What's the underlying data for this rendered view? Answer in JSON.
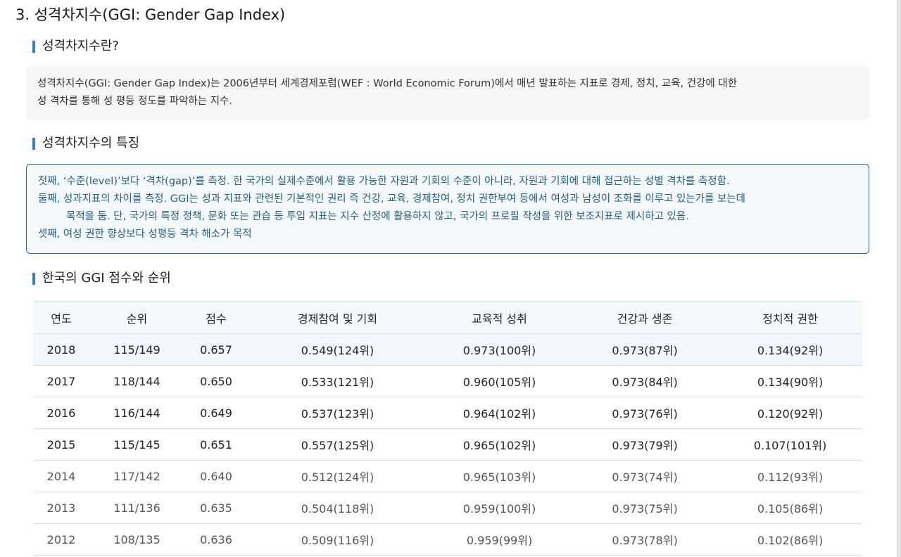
{
  "title": "3. 성격차지수(GGI: Gender Gap Index)",
  "sections": {
    "definition": {
      "heading": "성격차지수란?",
      "lines": [
        "성격차지수(GGI: Gender Gap Index)는 2006년부터 세계경제포럼(WEF : World Economic Forum)에서 매년 발표하는 지표로 경제, 정치, 교육, 건강에 대한",
        "성 격차를 통해 성 평등 정도를 파악하는 지수."
      ]
    },
    "features": {
      "heading": "성격차지수의 특징",
      "lines": [
        "첫째, ‘수준(level)’보다 ‘격차(gap)’를 측정. 한 국가의 실제수준에서 활용 가능한 자원과 기회의 수준이 아니라, 자원과 기회에 대해 접근하는 성별 격차를 측정함.",
        "둘째, 성과지표의 차이를 측정. GGI는 성과 지표와 관련된 기본적인 권리 즉 건강, 교육, 경제참여, 정치 권한부여 등에서 여성과 남성이 조화를 이루고 있는가를 보는데",
        "목적을 둠. 단, 국가의 특정 정책, 문화 또는 관습 등 투입 지표는 지수 산정에 활용하지 않고, 국가의 프로필 작성을 위한 보조지표로 제시하고 있음.",
        "셋째, 여성 권한 향상보다 성평등 격차 해소가 목적"
      ]
    },
    "korea": {
      "heading": "한국의 GGI 점수와 순위"
    }
  },
  "table": {
    "headers": [
      "연도",
      "순위",
      "점수",
      "경제참여 및 기회",
      "교육적 성취",
      "건강과 생존",
      "정치적 권한"
    ],
    "rows": [
      [
        "2018",
        "115/149",
        "0.657",
        "0.549(124위)",
        "0.973(100위)",
        "0.973(87위)",
        "0.134(92위)"
      ],
      [
        "2017",
        "118/144",
        "0.650",
        "0.533(121위)",
        "0.960(105위)",
        "0.973(84위)",
        "0.134(90위)"
      ],
      [
        "2016",
        "116/144",
        "0.649",
        "0.537(123위)",
        "0.964(102위)",
        "0.973(76위)",
        "0.120(92위)"
      ],
      [
        "2015",
        "115/145",
        "0.651",
        "0.557(125위)",
        "0.965(102위)",
        "0.973(79위)",
        "0.107(101위)"
      ],
      [
        "2014",
        "117/142",
        "0.640",
        "0.512(124위)",
        "0.965(103위)",
        "0.973(74위)",
        "0.112(93위)"
      ],
      [
        "2013",
        "111/136",
        "0.635",
        "0.504(118위)",
        "0.959(100위)",
        "0.973(75위)",
        "0.105(86위)"
      ],
      [
        "2012",
        "108/135",
        "0.636",
        "0.509(116위)",
        "0.959(99위)",
        "0.973(78위)",
        "0.102(86위)"
      ]
    ]
  }
}
